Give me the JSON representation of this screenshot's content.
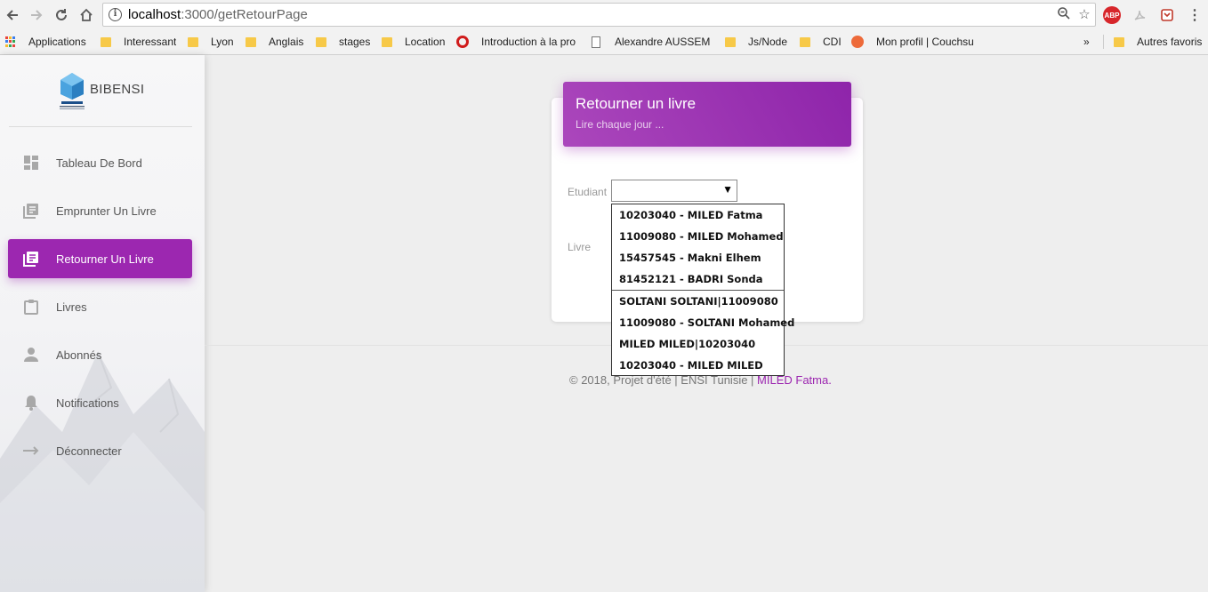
{
  "browser": {
    "url_host": "localhost",
    "url_path": ":3000/getRetourPage",
    "bookmarks": [
      {
        "label": "Applications",
        "icon": "apps-grid-icon"
      },
      {
        "label": "Interessant",
        "icon": "folder-icon"
      },
      {
        "label": "Lyon",
        "icon": "folder-icon"
      },
      {
        "label": "Anglais",
        "icon": "folder-icon"
      },
      {
        "label": "stages",
        "icon": "folder-icon"
      },
      {
        "label": "Location",
        "icon": "folder-icon"
      },
      {
        "label": "Introduction à la pro",
        "icon": "opera-icon"
      },
      {
        "label": "Alexandre AUSSEM |",
        "icon": "page-icon"
      },
      {
        "label": "Js/Node",
        "icon": "folder-icon"
      },
      {
        "label": "CDI",
        "icon": "folder-icon"
      },
      {
        "label": "Mon profil | Couchsu",
        "icon": "couchsurfing-icon"
      }
    ],
    "overflow": "»",
    "other_bookmarks": "Autres favoris"
  },
  "sidebar": {
    "logo_text": "BIBENSI",
    "items": [
      {
        "label": "Tableau De Bord",
        "icon": "dashboard-icon",
        "active": false
      },
      {
        "label": "Emprunter Un Livre",
        "icon": "library-books-icon",
        "active": false
      },
      {
        "label": "Retourner Un Livre",
        "icon": "library-books-icon",
        "active": true
      },
      {
        "label": "Livres",
        "icon": "clipboard-icon",
        "active": false
      },
      {
        "label": "Abonnés",
        "icon": "person-icon",
        "active": false
      },
      {
        "label": "Notifications",
        "icon": "bell-icon",
        "active": false
      },
      {
        "label": "Déconnecter",
        "icon": "arrow-right-icon",
        "active": false
      }
    ]
  },
  "card": {
    "title": "Retourner un livre",
    "subtitle": "Lire chaque jour ...",
    "etudiant_label": "Etudiant",
    "livre_label": "Livre",
    "etudiant_value": "",
    "options": [
      "10203040 - MILED Fatma",
      "11009080 - MILED Mohamed",
      "15457545 - Makni Elhem",
      "81452121 - BADRI Sonda",
      "SOLTANI SOLTANI|11009080",
      "11009080 - SOLTANI Mohamed",
      "MILED MILED|10203040",
      "10203040 - MILED MILED"
    ]
  },
  "footer": {
    "text": "© 2018, Projet d'été | ENSI Tunisie | ",
    "author": "MILED Fatma."
  },
  "colors": {
    "accent": "#9c27b0",
    "header_gradient_start": "#ab47bc",
    "header_gradient_end": "#8e24aa"
  }
}
